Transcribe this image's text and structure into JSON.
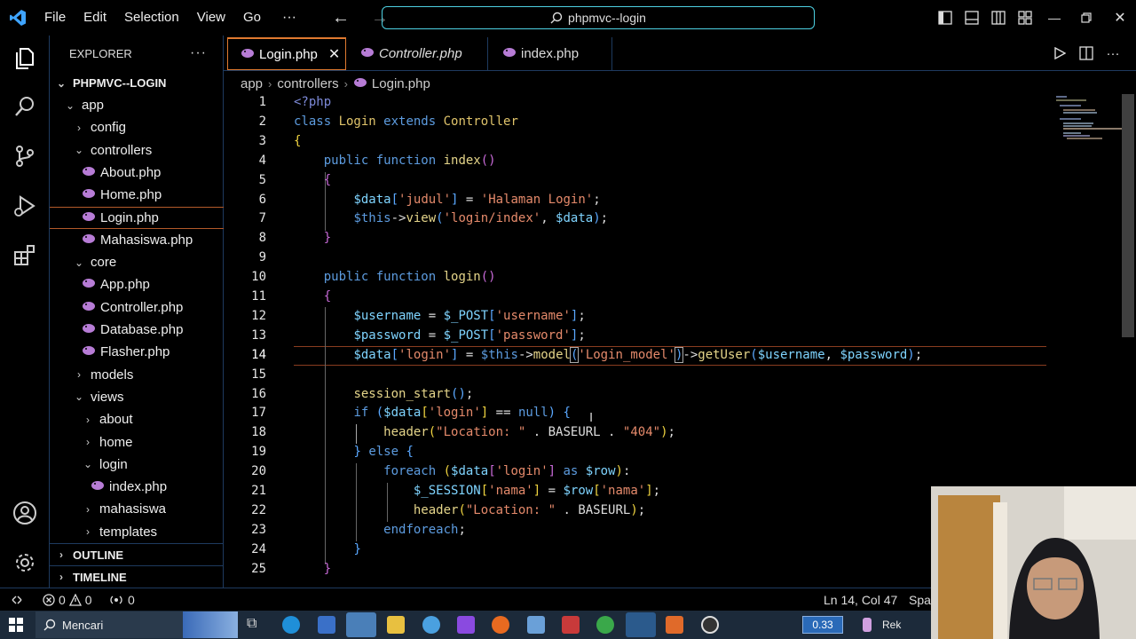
{
  "menu": [
    "File",
    "Edit",
    "Selection",
    "View",
    "Go"
  ],
  "command_center": "phpmvc--login",
  "explorer": {
    "title": "EXPLORER",
    "root": "PHPMVC--LOGIN",
    "tree": [
      {
        "label": "app",
        "depth": 1,
        "type": "folder-open"
      },
      {
        "label": "config",
        "depth": 2,
        "type": "folder"
      },
      {
        "label": "controllers",
        "depth": 2,
        "type": "folder-open"
      },
      {
        "label": "About.php",
        "depth": 3,
        "type": "file"
      },
      {
        "label": "Home.php",
        "depth": 3,
        "type": "file"
      },
      {
        "label": "Login.php",
        "depth": 3,
        "type": "file",
        "selected": true
      },
      {
        "label": "Mahasiswa.php",
        "depth": 3,
        "type": "file"
      },
      {
        "label": "core",
        "depth": 2,
        "type": "folder-open"
      },
      {
        "label": "App.php",
        "depth": 3,
        "type": "file"
      },
      {
        "label": "Controller.php",
        "depth": 3,
        "type": "file"
      },
      {
        "label": "Database.php",
        "depth": 3,
        "type": "file"
      },
      {
        "label": "Flasher.php",
        "depth": 3,
        "type": "file"
      },
      {
        "label": "models",
        "depth": 2,
        "type": "folder"
      },
      {
        "label": "views",
        "depth": 2,
        "type": "folder-open"
      },
      {
        "label": "about",
        "depth": 3,
        "type": "folder"
      },
      {
        "label": "home",
        "depth": 3,
        "type": "folder"
      },
      {
        "label": "login",
        "depth": 3,
        "type": "folder-open"
      },
      {
        "label": "index.php",
        "depth": 4,
        "type": "file"
      },
      {
        "label": "mahasiswa",
        "depth": 3,
        "type": "folder"
      },
      {
        "label": "templates",
        "depth": 3,
        "type": "folder"
      }
    ],
    "outline": "OUTLINE",
    "timeline": "TIMELINE"
  },
  "tabs": [
    {
      "label": "Login.php",
      "active": true
    },
    {
      "label": "Controller.php",
      "italic": true
    },
    {
      "label": "index.php"
    }
  ],
  "breadcrumb": [
    "app",
    "controllers",
    "Login.php"
  ],
  "editor": {
    "current_line": 14,
    "lines": [
      {
        "n": 1,
        "tokens": [
          [
            "<?php",
            "tag"
          ]
        ]
      },
      {
        "n": 2,
        "tokens": [
          [
            "class ",
            "kw"
          ],
          [
            "Login ",
            "cls"
          ],
          [
            "extends ",
            "kw"
          ],
          [
            "Controller",
            "cls"
          ]
        ]
      },
      {
        "n": 3,
        "tokens": [
          [
            "{",
            "br1"
          ]
        ]
      },
      {
        "n": 4,
        "tokens": [
          [
            "    "
          ],
          [
            "public ",
            "kw"
          ],
          [
            "function ",
            "kw"
          ],
          [
            "index",
            "fn"
          ],
          [
            "()",
            "br2"
          ]
        ]
      },
      {
        "n": 5,
        "tokens": [
          [
            "    "
          ],
          [
            "{",
            "br2"
          ]
        ]
      },
      {
        "n": 6,
        "tokens": [
          [
            "        "
          ],
          [
            "$data",
            "var"
          ],
          [
            "[",
            "br3"
          ],
          [
            "'judul'",
            "str"
          ],
          [
            "]",
            "br3"
          ],
          [
            " = "
          ],
          [
            "'Halaman Login'",
            "str"
          ],
          [
            ";"
          ]
        ]
      },
      {
        "n": 7,
        "tokens": [
          [
            "        "
          ],
          [
            "$this",
            "kw"
          ],
          [
            "->"
          ],
          [
            "view",
            "fn"
          ],
          [
            "(",
            "br3"
          ],
          [
            "'login/index'",
            "str"
          ],
          [
            ", "
          ],
          [
            "$data",
            "var"
          ],
          [
            ")",
            "br3"
          ],
          [
            ";"
          ]
        ]
      },
      {
        "n": 8,
        "tokens": [
          [
            "    "
          ],
          [
            "}",
            "br2"
          ]
        ]
      },
      {
        "n": 9,
        "tokens": []
      },
      {
        "n": 10,
        "tokens": [
          [
            "    "
          ],
          [
            "public ",
            "kw"
          ],
          [
            "function ",
            "kw"
          ],
          [
            "login",
            "fn"
          ],
          [
            "()",
            "br2"
          ]
        ]
      },
      {
        "n": 11,
        "tokens": [
          [
            "    "
          ],
          [
            "{",
            "br2"
          ]
        ]
      },
      {
        "n": 12,
        "tokens": [
          [
            "        "
          ],
          [
            "$username",
            "var"
          ],
          [
            " = "
          ],
          [
            "$_POST",
            "var"
          ],
          [
            "[",
            "br3"
          ],
          [
            "'username'",
            "str"
          ],
          [
            "]",
            "br3"
          ],
          [
            ";"
          ]
        ]
      },
      {
        "n": 13,
        "tokens": [
          [
            "        "
          ],
          [
            "$password",
            "var"
          ],
          [
            " = "
          ],
          [
            "$_POST",
            "var"
          ],
          [
            "[",
            "br3"
          ],
          [
            "'password'",
            "str"
          ],
          [
            "]",
            "br3"
          ],
          [
            ";"
          ]
        ]
      },
      {
        "n": 14,
        "tokens": [
          [
            "        "
          ],
          [
            "$data",
            "var"
          ],
          [
            "[",
            "br3"
          ],
          [
            "'login'",
            "str"
          ],
          [
            "]",
            "br3"
          ],
          [
            " = "
          ],
          [
            "$this",
            "kw"
          ],
          [
            "->"
          ],
          [
            "model",
            "fn"
          ],
          [
            "(",
            "br3 bm"
          ],
          [
            "'Login_model'",
            "str"
          ],
          [
            ")",
            "br3 bm"
          ],
          [
            "->"
          ],
          [
            "getUser",
            "fn"
          ],
          [
            "(",
            "br3"
          ],
          [
            "$username",
            "var"
          ],
          [
            ", "
          ],
          [
            "$password",
            "var"
          ],
          [
            ")",
            "br3"
          ],
          [
            ";"
          ]
        ]
      },
      {
        "n": 15,
        "tokens": []
      },
      {
        "n": 16,
        "tokens": [
          [
            "        "
          ],
          [
            "session_start",
            "fn"
          ],
          [
            "()",
            "br3"
          ],
          [
            ";"
          ]
        ]
      },
      {
        "n": 17,
        "tokens": [
          [
            "        "
          ],
          [
            "if ",
            "kw"
          ],
          [
            "(",
            "br3"
          ],
          [
            "$data",
            "var"
          ],
          [
            "[",
            "br1"
          ],
          [
            "'login'",
            "str"
          ],
          [
            "]",
            "br1"
          ],
          [
            " == "
          ],
          [
            "null",
            "kw"
          ],
          [
            ")",
            "br3"
          ],
          [
            " "
          ],
          [
            "{",
            "br3"
          ]
        ]
      },
      {
        "n": 18,
        "tokens": [
          [
            "            "
          ],
          [
            "header",
            "fn"
          ],
          [
            "(",
            "br1"
          ],
          [
            "\"Location: \"",
            "str"
          ],
          [
            " . BASEURL . "
          ],
          [
            "\"404\"",
            "str"
          ],
          [
            ")",
            "br1"
          ],
          [
            ";"
          ]
        ]
      },
      {
        "n": 19,
        "tokens": [
          [
            "        "
          ],
          [
            "}",
            "br3"
          ],
          [
            " "
          ],
          [
            "else ",
            "kw"
          ],
          [
            "{",
            "br3"
          ]
        ]
      },
      {
        "n": 20,
        "tokens": [
          [
            "            "
          ],
          [
            "foreach ",
            "kw"
          ],
          [
            "(",
            "br1"
          ],
          [
            "$data",
            "var"
          ],
          [
            "[",
            "br2"
          ],
          [
            "'login'",
            "str"
          ],
          [
            "]",
            "br2"
          ],
          [
            " as ",
            "kw"
          ],
          [
            "$row",
            "var"
          ],
          [
            ")",
            "br1"
          ],
          [
            ":"
          ]
        ]
      },
      {
        "n": 21,
        "tokens": [
          [
            "                "
          ],
          [
            "$_SESSION",
            "var"
          ],
          [
            "[",
            "br1"
          ],
          [
            "'nama'",
            "str"
          ],
          [
            "]",
            "br1"
          ],
          [
            " = "
          ],
          [
            "$row",
            "var"
          ],
          [
            "[",
            "br1"
          ],
          [
            "'nama'",
            "str"
          ],
          [
            "]",
            "br1"
          ],
          [
            ";"
          ]
        ]
      },
      {
        "n": 22,
        "tokens": [
          [
            "                "
          ],
          [
            "header",
            "fn"
          ],
          [
            "(",
            "br1"
          ],
          [
            "\"Location: \"",
            "str"
          ],
          [
            " . BASEURL"
          ],
          [
            ")",
            "br1"
          ],
          [
            ";"
          ]
        ]
      },
      {
        "n": 23,
        "tokens": [
          [
            "            "
          ],
          [
            "endforeach",
            "kw"
          ],
          [
            ";"
          ]
        ]
      },
      {
        "n": 24,
        "tokens": [
          [
            "        "
          ],
          [
            "}",
            "br3"
          ]
        ]
      },
      {
        "n": 25,
        "tokens": [
          [
            "    "
          ],
          [
            "}",
            "br2"
          ]
        ]
      }
    ]
  },
  "status": {
    "errors": "0",
    "warnings": "0",
    "ports": "0",
    "position": "Ln 14, Col 47",
    "spaces": "Spac"
  },
  "taskbar": {
    "search_placeholder": "Mencari",
    "net_speed": "0.33",
    "rec_label": "Rek"
  },
  "colors": {
    "accent": "#e07a30",
    "focus_border": "#4dd0e1",
    "php_icon": "#b77cd6",
    "vscode_blue": "#3fa4ff"
  }
}
